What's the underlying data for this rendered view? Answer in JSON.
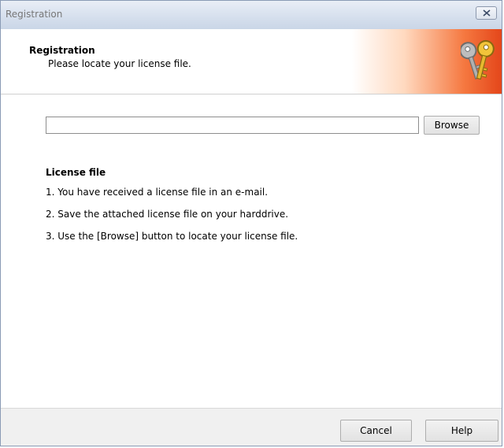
{
  "window": {
    "title": "Registration"
  },
  "header": {
    "title": "Registration",
    "subtitle": "Please locate your license file."
  },
  "form": {
    "path_value": "",
    "browse_label": "Browse"
  },
  "instructions": {
    "title": "License file",
    "steps": [
      "1. You have received a license file in an e-mail.",
      "2. Save the attached license file on your harddrive.",
      "3. Use the [Browse] button to locate your license file."
    ]
  },
  "footer": {
    "cancel_label": "Cancel",
    "help_label": "Help"
  },
  "icons": {
    "close": "close-icon",
    "header": "keys-icon"
  },
  "colors": {
    "header_accent": "#e4461a",
    "title_text": "#777777"
  }
}
